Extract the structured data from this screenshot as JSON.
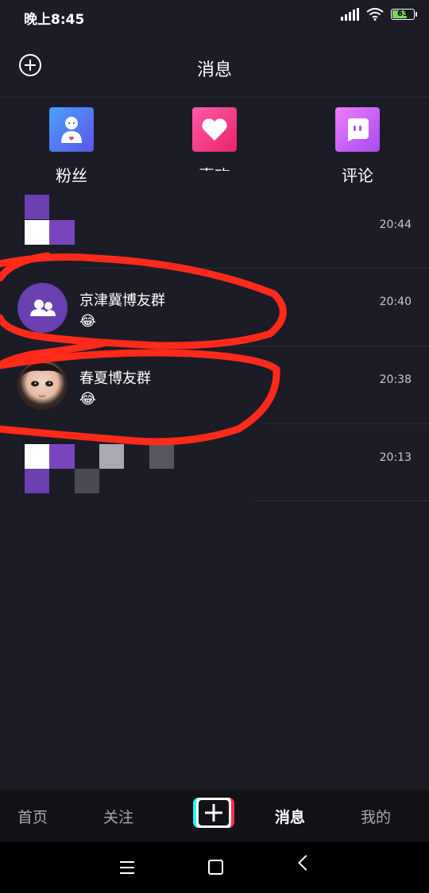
{
  "status_bar": {
    "time": "晚上8:45",
    "battery": "63"
  },
  "header": {
    "title": "消息"
  },
  "quick_actions": [
    {
      "label": "粉丝",
      "icon": "fans-icon"
    },
    {
      "label": "喜欢",
      "icon": "heart-icon"
    },
    {
      "label": "评论",
      "icon": "comment-icon"
    }
  ],
  "conversations": [
    {
      "time": "20:44"
    },
    {
      "name": "京津冀博友群",
      "preview": "😂",
      "time": "20:40"
    },
    {
      "name": "春夏博友群",
      "preview": "😂",
      "time": "20:38"
    },
    {
      "time": "20:13"
    }
  ],
  "tabbar": {
    "home": "首页",
    "follow": "关注",
    "messages": "消息",
    "me": "我的"
  },
  "colors": {
    "background": "#1c1c26",
    "annotation": "#ff2a1a",
    "group_avatar": "#6a3fb0"
  }
}
